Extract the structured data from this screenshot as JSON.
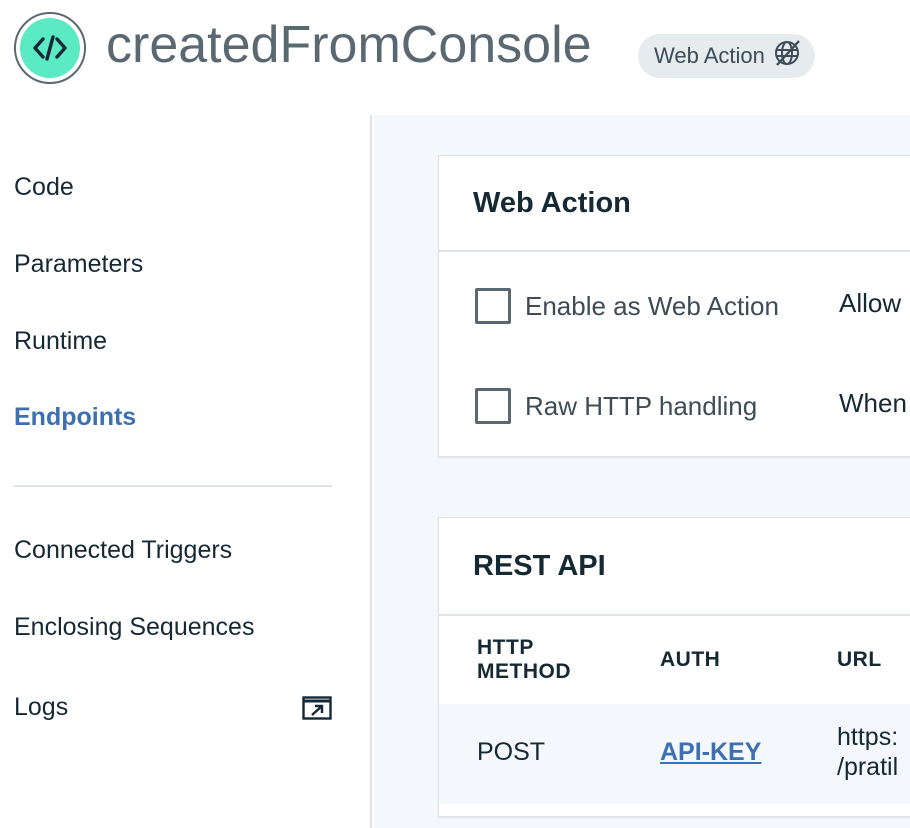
{
  "header": {
    "title": "createdFromConsole",
    "badge_label": "Web Action",
    "logo_icon": "code-brackets-icon",
    "badge_icon": "web-action-off-icon"
  },
  "sidebar": {
    "items": [
      {
        "label": "Code"
      },
      {
        "label": "Parameters"
      },
      {
        "label": "Runtime"
      },
      {
        "label": "Endpoints",
        "active": true
      },
      {
        "label": "Connected Triggers"
      },
      {
        "label": "Enclosing Sequences"
      },
      {
        "label": "Logs",
        "icon": "external-link-icon"
      }
    ]
  },
  "web_action_card": {
    "title": "Web Action",
    "options": [
      {
        "label": "Enable as Web Action",
        "checked": false,
        "description": "Allow"
      },
      {
        "label": "Raw HTTP handling",
        "checked": false,
        "description": "When"
      }
    ]
  },
  "rest_api_card": {
    "title": "REST API",
    "columns": [
      "HTTP METHOD",
      "AUTH",
      "URL"
    ],
    "column_lines": {
      "method": [
        "HTTP",
        "METHOD"
      ]
    },
    "rows": [
      {
        "method": "POST",
        "auth": "API-KEY",
        "url_lines": [
          "https:",
          "/pratil"
        ]
      }
    ]
  },
  "colors": {
    "accent": "#3d70b2",
    "logo": "#5aeac4",
    "background": "#f4f7fb"
  }
}
